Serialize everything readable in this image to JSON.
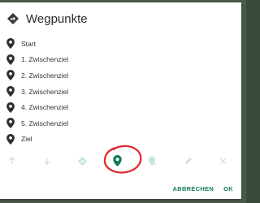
{
  "dialog": {
    "title": "Wegpunkte",
    "header_icon": "directions-icon",
    "items": [
      {
        "label": "Start"
      },
      {
        "label": "1. Zwischenziel"
      },
      {
        "label": "2. Zwischenziel"
      },
      {
        "label": "3. Zwischenziel"
      },
      {
        "label": "4. Zwischenziel"
      },
      {
        "label": "5. Zwischenziel"
      },
      {
        "label": "Ziel"
      }
    ],
    "toolbar": [
      "arrow-up-icon",
      "arrow-down-icon",
      "directions-icon",
      "map-marker-icon",
      "marker-off-icon",
      "edit-icon",
      "close-icon"
    ],
    "actions": {
      "cancel": "ABBRECHEN",
      "ok": "OK"
    }
  },
  "colors": {
    "accent": "#0f7a5f",
    "toolbar_disabled": "#c9e3dc",
    "annotation": "#e0262b"
  }
}
